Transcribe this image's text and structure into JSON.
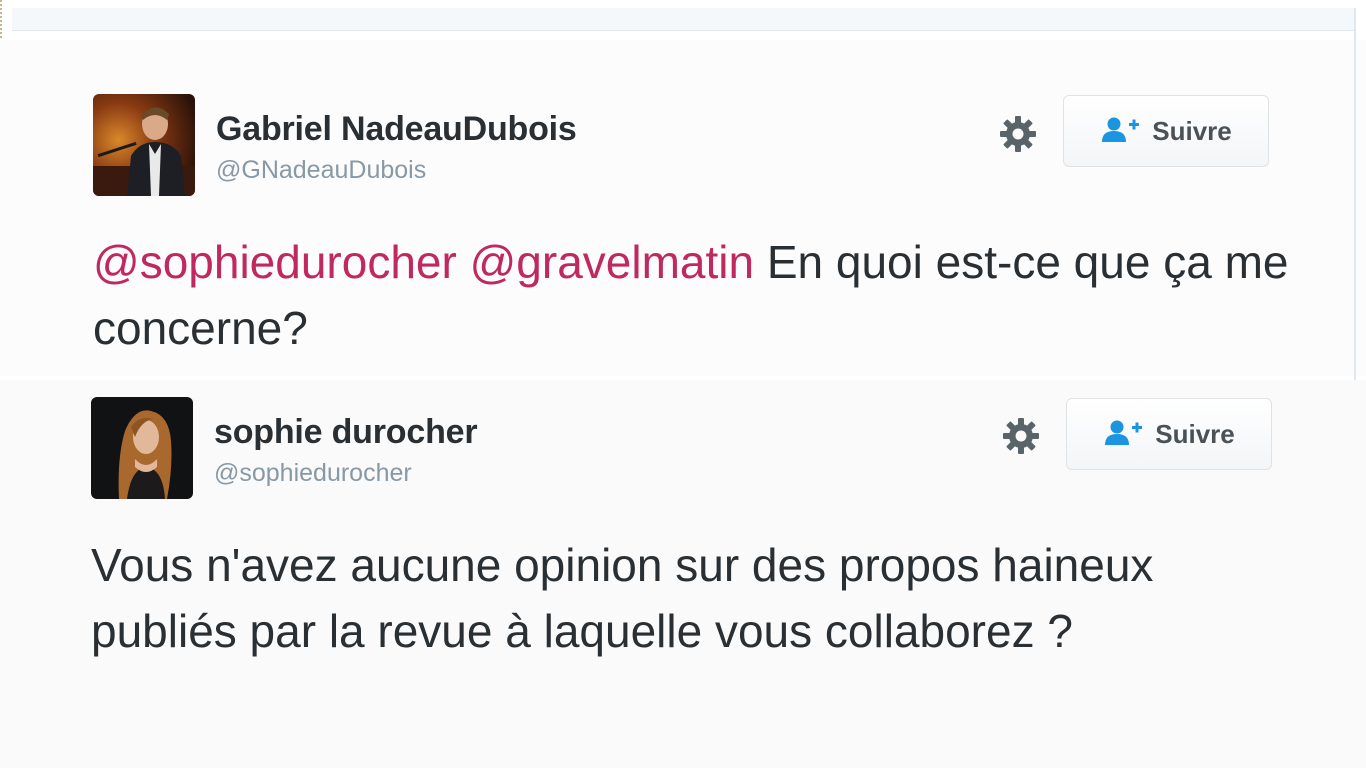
{
  "tweets": [
    {
      "author_name": "Gabriel NadeauDubois",
      "author_handle": "@GNadeauDubois",
      "mention_1": "@sophiedurocher",
      "mention_2": "@gravelmatin",
      "text_rest": "En quoi est-ce que ça me concerne?",
      "follow_label": "Suivre",
      "settings_icon": "gear-icon",
      "follow_icon": "add-user-icon"
    },
    {
      "author_name": "sophie durocher",
      "author_handle": "@sophiedurocher",
      "text": "Vous n'avez aucune opinion sur des propos haineux publiés par la revue à laquelle vous collaborez  ?",
      "follow_label": "Suivre",
      "settings_icon": "gear-icon",
      "follow_icon": "add-user-icon"
    }
  ],
  "colors": {
    "mention": "#c0295f",
    "text": "#292f33",
    "handle": "#8899a6",
    "follow_icon": "#1b95e0"
  }
}
